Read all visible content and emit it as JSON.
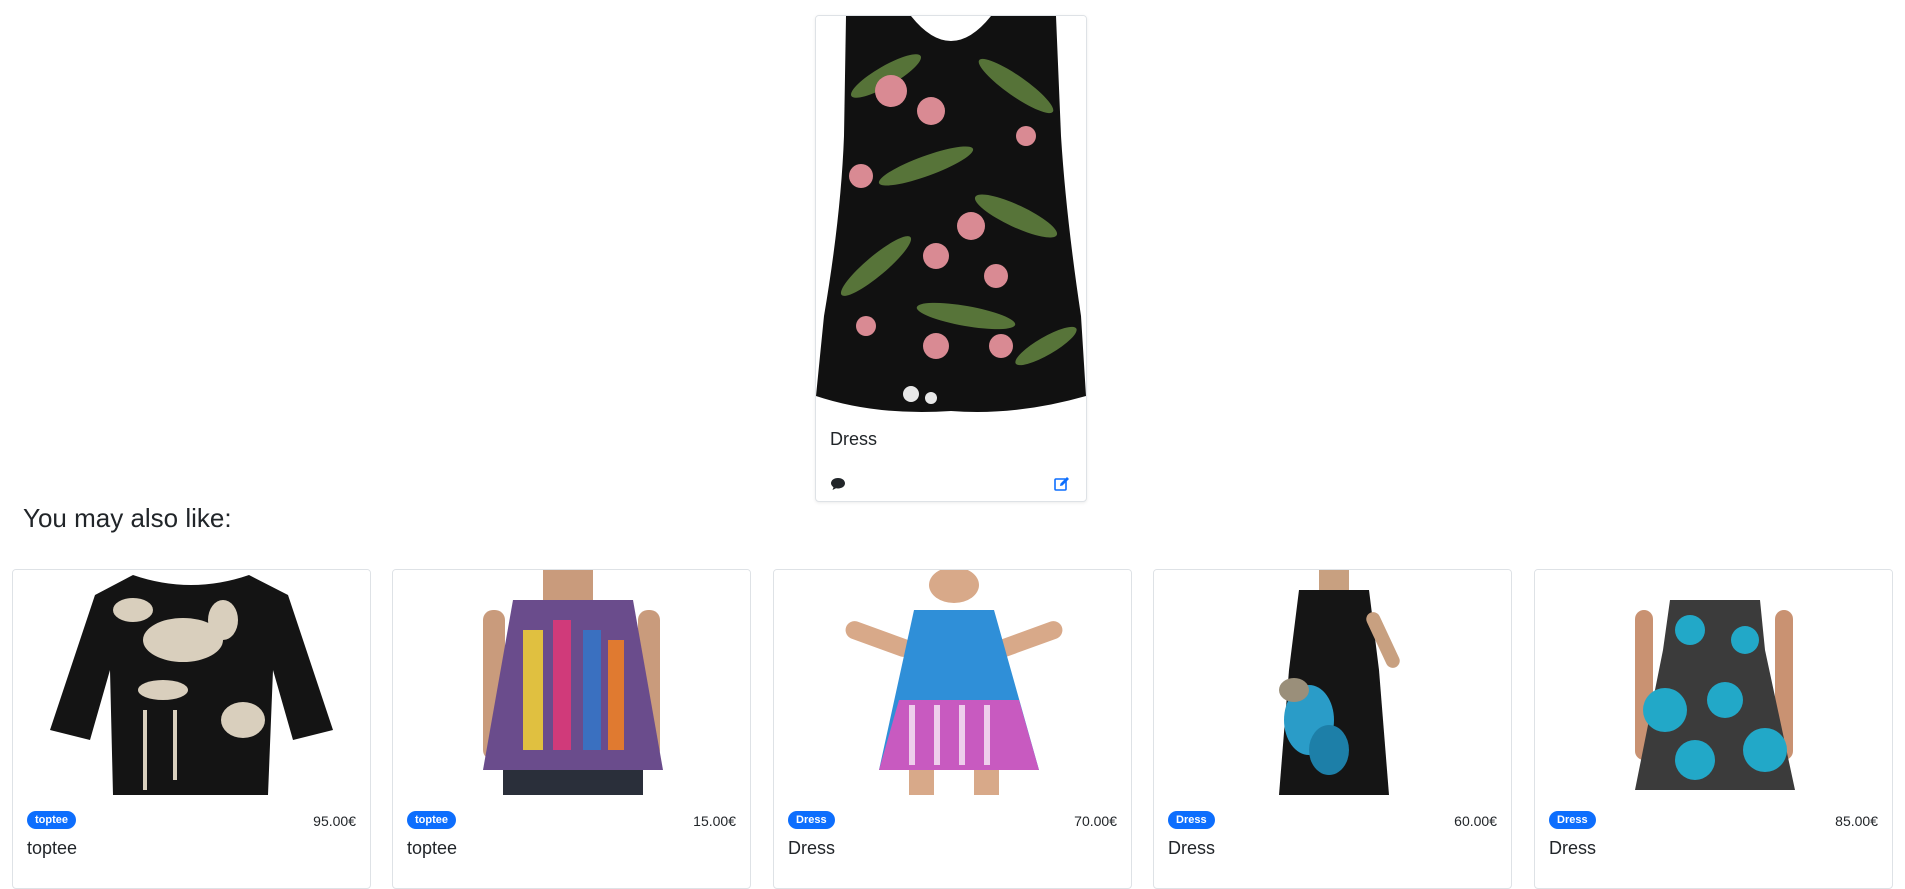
{
  "featured": {
    "title": "Dress",
    "actions": {
      "comment_icon": "comment-icon",
      "edit_icon": "edit-icon"
    },
    "accent_color": "#0d6efd"
  },
  "section_heading": "You may also like:",
  "related": [
    {
      "badge": "toptee",
      "price": "95.00€",
      "name": "toptee"
    },
    {
      "badge": "toptee",
      "price": "15.00€",
      "name": "toptee"
    },
    {
      "badge": "Dress",
      "price": "70.00€",
      "name": "Dress"
    },
    {
      "badge": "Dress",
      "price": "60.00€",
      "name": "Dress"
    },
    {
      "badge": "Dress",
      "price": "85.00€",
      "name": "Dress"
    }
  ]
}
